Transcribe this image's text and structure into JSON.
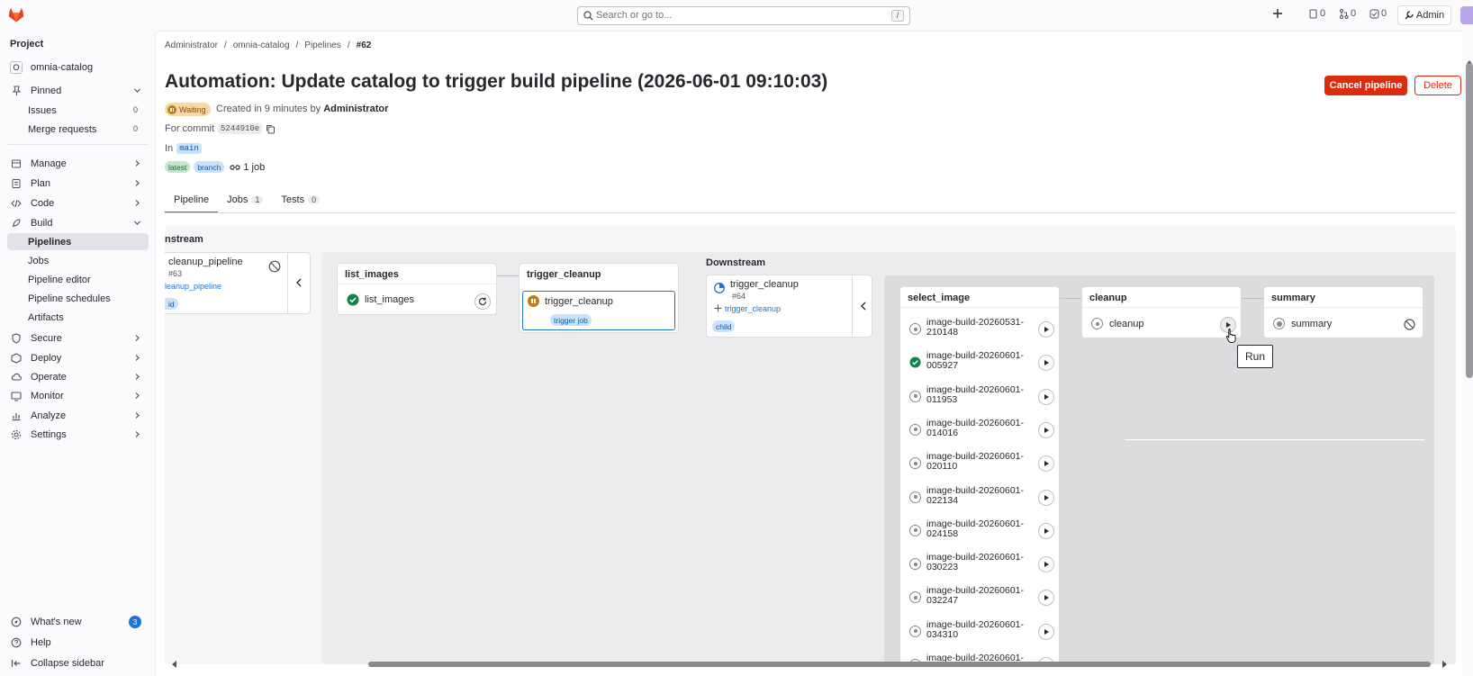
{
  "topbar": {
    "search_placeholder": "Search or go to...",
    "search_shortcut": "/",
    "issues_count": "0",
    "mr_count": "0",
    "todo_count": "0",
    "admin_label": "Admin"
  },
  "sidebar": {
    "heading": "Project",
    "project_initial": "O",
    "project_name": "omnia-catalog",
    "pinned_label": "Pinned",
    "pinned_items": [
      {
        "label": "Issues",
        "count": "0"
      },
      {
        "label": "Merge requests",
        "count": "0"
      }
    ],
    "sections": [
      "Manage",
      "Plan",
      "Code",
      "Build"
    ],
    "build_items": [
      "Pipelines",
      "Jobs",
      "Pipeline editor",
      "Pipeline schedules",
      "Artifacts"
    ],
    "more_sections": [
      "Secure",
      "Deploy",
      "Operate",
      "Monitor",
      "Analyze",
      "Settings"
    ],
    "whats_new": "What's new",
    "whats_new_count": "3",
    "help": "Help",
    "collapse": "Collapse sidebar"
  },
  "breadcrumbs": [
    "Administrator",
    "omnia-catalog",
    "Pipelines",
    "#62"
  ],
  "pipeline": {
    "title": "Automation: Update catalog to trigger build pipeline (2026-06-01 09:10:03)",
    "status": "Waiting",
    "created_prefix": "Created in 9 minutes by",
    "created_by": "Administrator",
    "commit_prefix": "For commit",
    "commit_sha": "5244910e",
    "in_prefix": "In",
    "ref": "main",
    "badges": [
      "latest",
      "branch"
    ],
    "jobs_link": "1 job",
    "cancel_label": "Cancel pipeline",
    "delete_label": "Delete"
  },
  "tabs": [
    {
      "label": "Pipeline",
      "count": ""
    },
    {
      "label": "Jobs",
      "count": "1"
    },
    {
      "label": "Tests",
      "count": "0"
    }
  ],
  "graph": {
    "upstream_heading": "nstream",
    "upstream": {
      "name": "cleanup_pipeline",
      "id": "#63",
      "source": "leanup_pipeline",
      "pill": "id"
    },
    "stages": [
      {
        "name": "list_images",
        "jobs": [
          "list_images"
        ]
      },
      {
        "name": "trigger_cleanup",
        "jobs": [
          "trigger_cleanup"
        ],
        "job_pill": "trigger job"
      }
    ],
    "downstream_heading": "Downstream",
    "downstream": {
      "name": "trigger_cleanup",
      "id": "#64",
      "source": "trigger_cleanup",
      "pill": "child"
    },
    "child_stages": [
      {
        "name": "select_image",
        "jobs": [
          [
            "image-build-20260531-",
            "210148"
          ],
          [
            "image-build-20260601-",
            "005927"
          ],
          [
            "image-build-20260601-",
            "011953"
          ],
          [
            "image-build-20260601-",
            "014016"
          ],
          [
            "image-build-20260601-",
            "020110"
          ],
          [
            "image-build-20260601-",
            "022134"
          ],
          [
            "image-build-20260601-",
            "024158"
          ],
          [
            "image-build-20260601-",
            "030223"
          ],
          [
            "image-build-20260601-",
            "032247"
          ],
          [
            "image-build-20260601-",
            "034310"
          ],
          [
            "image-build-20260601-",
            ""
          ]
        ]
      },
      {
        "name": "cleanup",
        "jobs": [
          "cleanup"
        ]
      },
      {
        "name": "summary",
        "jobs": [
          "summary"
        ]
      }
    ],
    "tooltip": "Run"
  },
  "colors": {
    "danger": "#dd2b0e",
    "success": "#108548",
    "waiting": "#c17d10",
    "link": "#1f75cb"
  }
}
